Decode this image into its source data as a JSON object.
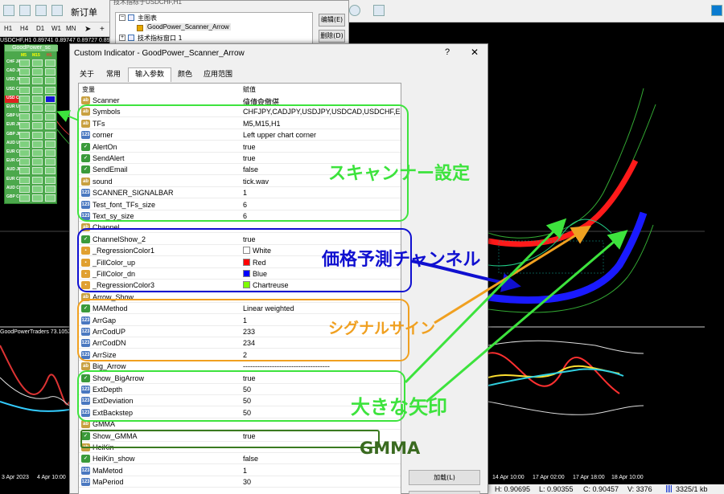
{
  "toolbar": {
    "new_order_label": "新订单"
  },
  "timeframes": [
    "H1",
    "H4",
    "D1",
    "W1",
    "MN"
  ],
  "chart": {
    "title": "USDCHF,H1  0.89741 0.89747 0.89727 0.897",
    "subwindow_title": "GoodPowerTraders 73.1052",
    "scanner": {
      "title": "GoodPower_sc",
      "columns": [
        "M5",
        "M15",
        "H1"
      ],
      "pairs": [
        "CHF JPY",
        "CAD JPY",
        "USD JPY",
        "USD CAD",
        "USD CHF",
        "EUR USD",
        "GBP USD",
        "EUR JPY",
        "GBP JPY",
        "AUD USD",
        "EUR CHF",
        "EUR GBP",
        "AUD JPY",
        "EUR CAD",
        "AUD CHF",
        "GBP CHF"
      ]
    },
    "axis_left": [
      "3 Apr 2023",
      "4 Apr 10:00"
    ],
    "axis_right": [
      "14 Apr 10:00",
      "17 Apr 02:00",
      "17 Apr 18:00",
      "18 Apr 10:00"
    ],
    "status": {
      "high": "H: 0.90695",
      "low": "L: 0.90355",
      "close": "C: 0.90457",
      "volume": "V: 3376",
      "bars": "3325/1 kb"
    }
  },
  "objects_dialog": {
    "title": "技术指标于USDCHF,H1",
    "tree": [
      {
        "label": "主图表"
      },
      {
        "label": "GoodPower_Scanner_Arrow"
      },
      {
        "label": "技术指标窗口 1"
      }
    ],
    "edit_button": "编辑(E)",
    "delete_button": "删除(D)"
  },
  "dialog": {
    "title": "Custom Indicator - GoodPower_Scanner_Arrow",
    "help": "?",
    "close": "✕",
    "tabs": [
      "关于",
      "常用",
      "输入参数",
      "颜色",
      "应用范围"
    ],
    "active_tab": "输入参数",
    "header": {
      "variable": "变量",
      "value": "赋值"
    },
    "params": [
      {
        "icon": "ab",
        "name": "Scanner",
        "value": "僋僓僉僌偡"
      },
      {
        "icon": "ab",
        "name": "Symbols",
        "value": "CHFJPY,CADJPY,USDJPY,USDCAD,USDCHF,E..."
      },
      {
        "icon": "ab",
        "name": "TFs",
        "value": "M5,M15,H1"
      },
      {
        "icon": "123",
        "name": "corner",
        "value": "Left upper chart corner"
      },
      {
        "icon": "bool",
        "name": "AlertOn",
        "value": "true"
      },
      {
        "icon": "bool",
        "name": "SendAlert",
        "value": "true"
      },
      {
        "icon": "bool",
        "name": "SendEmail",
        "value": "false"
      },
      {
        "icon": "ab",
        "name": "sound",
        "value": "tick.wav"
      },
      {
        "icon": "123",
        "name": "SCANNER_SIGNALBAR",
        "value": "1"
      },
      {
        "icon": "123",
        "name": "Test_font_TFs_size",
        "value": "6"
      },
      {
        "icon": "123",
        "name": "Text_sy_size",
        "value": "6"
      },
      {
        "icon": "ab",
        "name": "Channel",
        "value": ""
      },
      {
        "icon": "bool",
        "name": "ChannelShow_2",
        "value": "true"
      },
      {
        "icon": "color",
        "name": "_RegressionColor1",
        "value": "White",
        "swatch": "#ffffff"
      },
      {
        "icon": "color",
        "name": "_FillColor_up",
        "value": "Red",
        "swatch": "#ff0000"
      },
      {
        "icon": "color",
        "name": "_FillColor_dn",
        "value": "Blue",
        "swatch": "#0000ff"
      },
      {
        "icon": "color",
        "name": "_RegressionColor3",
        "value": "Chartreuse",
        "swatch": "#7fff00"
      },
      {
        "icon": "ab",
        "name": "Arrow_Show",
        "value": ""
      },
      {
        "icon": "bool",
        "name": "MAMethod",
        "value": "Linear weighted"
      },
      {
        "icon": "123",
        "name": "ArrGap",
        "value": "1"
      },
      {
        "icon": "123",
        "name": "ArrCodUP",
        "value": "233"
      },
      {
        "icon": "123",
        "name": "ArrCodDN",
        "value": "234"
      },
      {
        "icon": "123",
        "name": "ArrSize",
        "value": "2"
      },
      {
        "icon": "ab",
        "name": "Big_Arrow",
        "value": "------------------------------------"
      },
      {
        "icon": "bool",
        "name": "Show_BigArrow",
        "value": "true"
      },
      {
        "icon": "123",
        "name": "ExtDepth",
        "value": "50"
      },
      {
        "icon": "123",
        "name": "ExtDeviation",
        "value": "50"
      },
      {
        "icon": "123",
        "name": "ExtBackstep",
        "value": "50"
      },
      {
        "icon": "ab",
        "name": "GMMA",
        "value": ""
      },
      {
        "icon": "bool",
        "name": "Show_GMMA",
        "value": "true"
      },
      {
        "icon": "ab",
        "name": "HeiKin",
        "value": "------------------------------------"
      },
      {
        "icon": "bool",
        "name": "HeiKin_show",
        "value": "false"
      },
      {
        "icon": "123",
        "name": "MaMetod",
        "value": "1"
      },
      {
        "icon": "123",
        "name": "MaPeriod",
        "value": "30"
      }
    ],
    "load_button": "加载(L)"
  },
  "annotations": {
    "scanner_settings": "スキャンナー設定",
    "price_channel": "価格予測チャンネル",
    "signal_sign": "シグナルサイン",
    "big_arrow": "大きな矢印",
    "gmma": "GMMA"
  },
  "colors": {
    "annot_green": "#3de33d",
    "annot_blue": "#1010d0",
    "annot_orange": "#f0a020",
    "annot_dark_green": "#3a7a20"
  }
}
